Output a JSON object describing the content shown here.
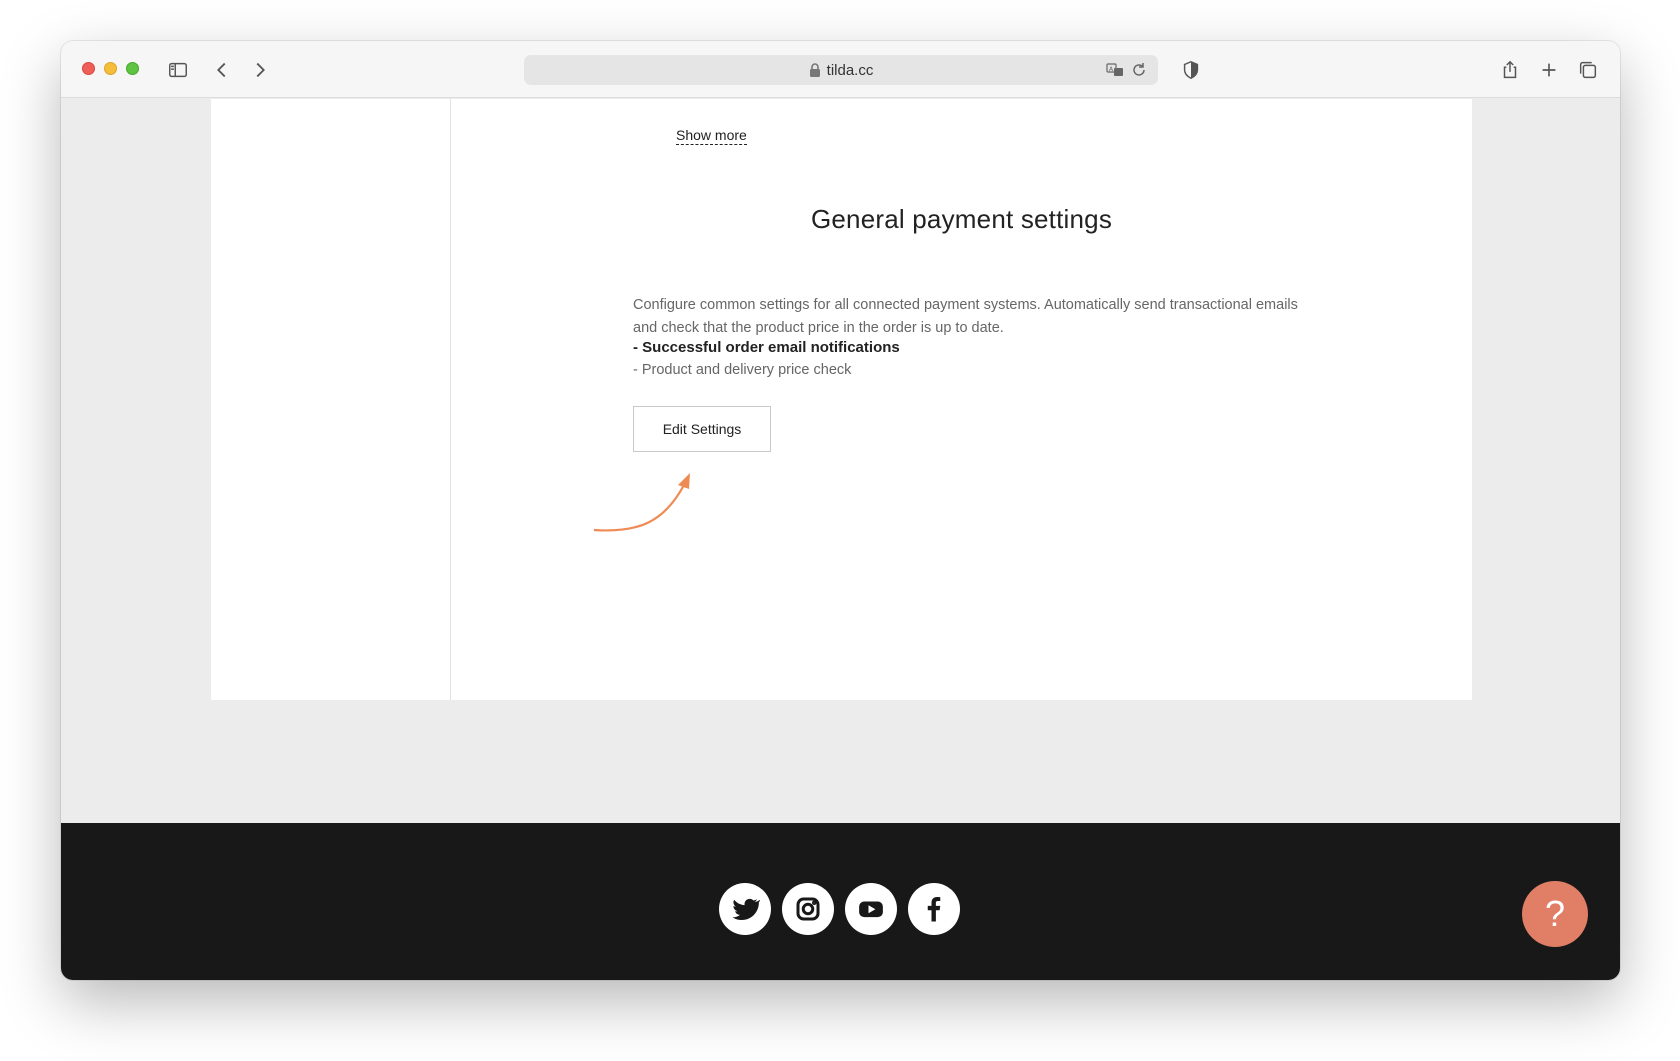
{
  "browser": {
    "url": "tilda.cc",
    "icons": {
      "sidebar": "sidebar-icon",
      "back": "chevron-left-icon",
      "forward": "chevron-right-icon",
      "lock": "lock-icon",
      "translate": "translate-icon",
      "reload": "reload-icon",
      "shield": "shield-icon",
      "share": "share-icon",
      "new_tab": "plus-icon",
      "tabs": "tabs-icon"
    }
  },
  "page": {
    "show_more": "Show more",
    "section_title": "General payment settings",
    "description": "Configure common settings for all connected payment systems. Automatically send transactional emails and check that the product price in the order is up to date.",
    "bullets": [
      "- Successful order email notifications",
      "- Product and delivery price check"
    ],
    "edit_button": "Edit Settings"
  },
  "footer": {
    "socials": [
      "twitter-icon",
      "instagram-icon",
      "youtube-icon",
      "facebook-icon"
    ],
    "help_label": "?"
  },
  "colors": {
    "accent_arrow": "#f08a55",
    "help_button": "#e07e66",
    "footer_bg": "#181818"
  }
}
